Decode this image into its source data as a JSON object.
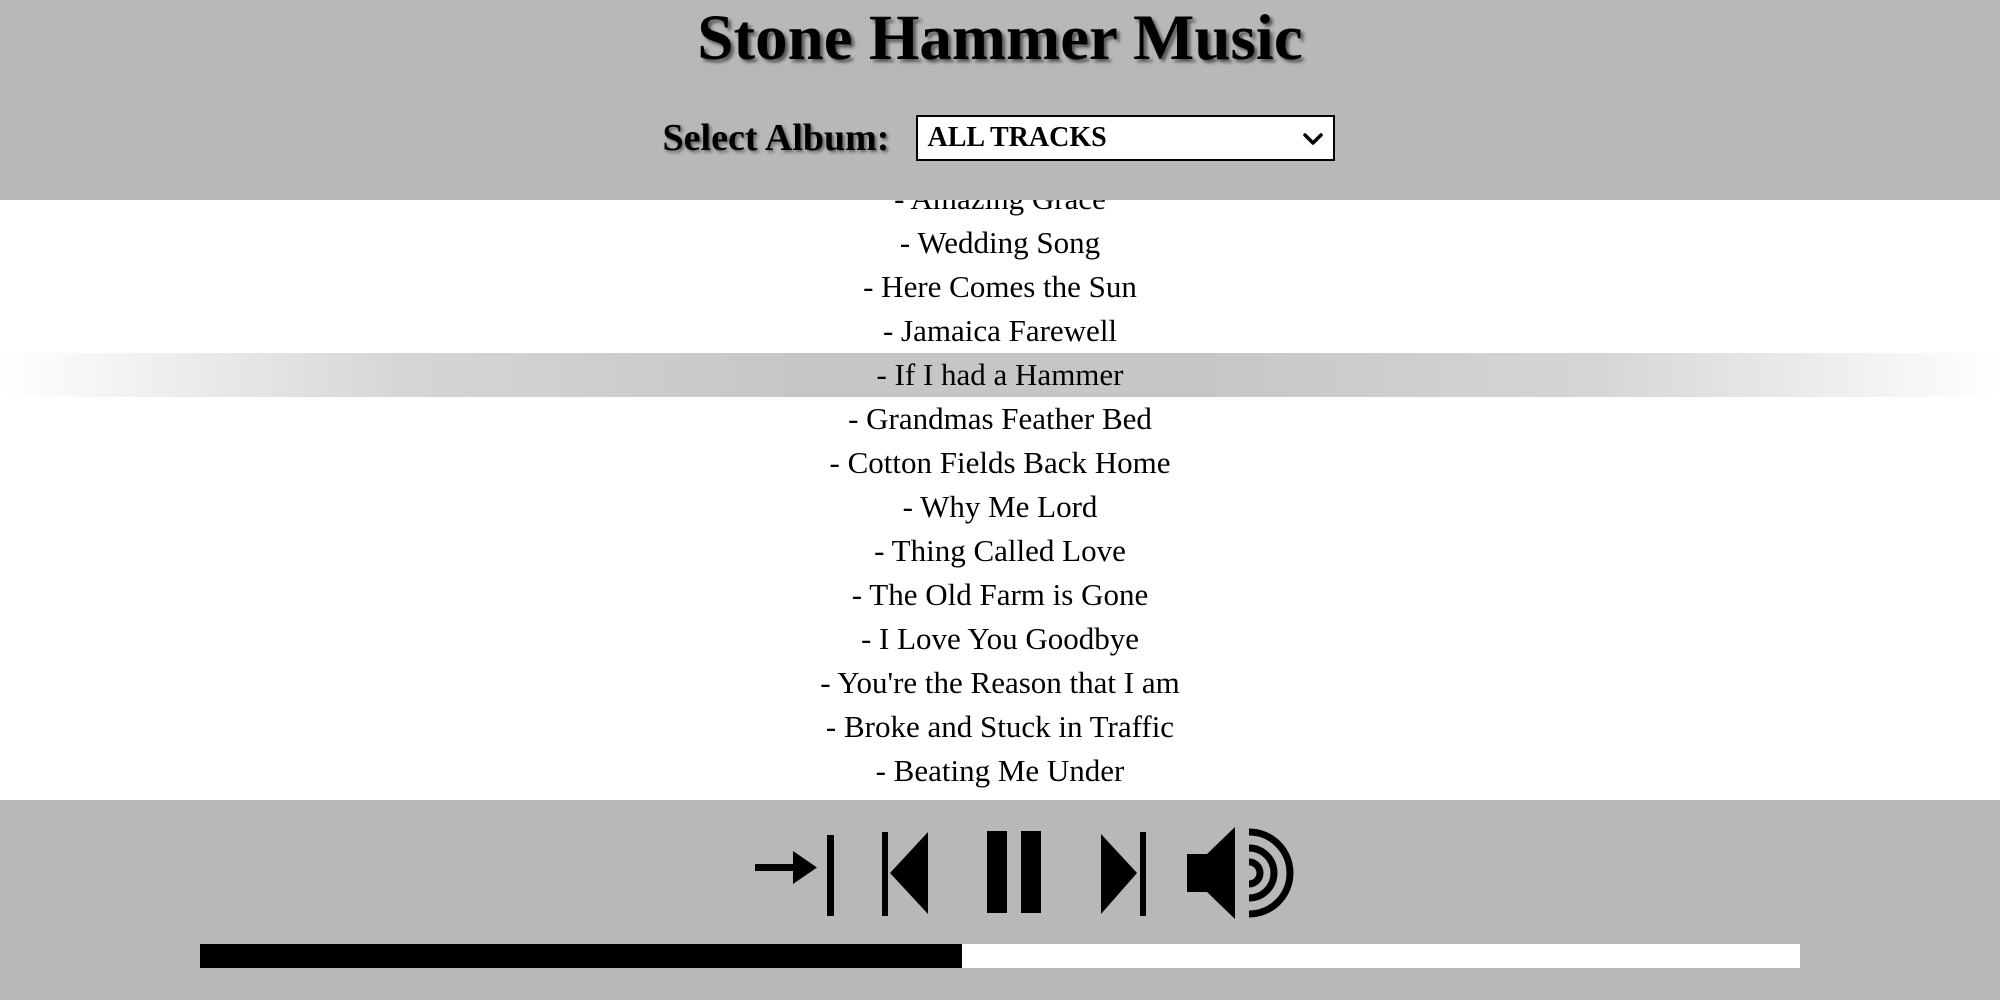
{
  "header": {
    "title": "Stone Hammer Music",
    "album_label": "Select Album:",
    "album_selected": "ALL TRACKS"
  },
  "tracks": [
    "- Amazing Grace",
    "- Wedding Song",
    "- Here Comes the Sun",
    "- Jamaica Farewell",
    "- If I had a Hammer",
    "- Grandmas Feather Bed",
    "- Cotton Fields Back Home",
    "- Why Me Lord",
    "- Thing Called Love",
    "- The Old Farm is Gone",
    "- I Love You Goodbye",
    "- You're the Reason that I am",
    "- Broke and Stuck in Traffic",
    "- Beating Me Under"
  ],
  "active_track_index": 4,
  "player": {
    "controls": [
      "shuffle-icon",
      "previous-icon",
      "pause-icon",
      "next-icon",
      "volume-icon"
    ],
    "progress_fraction": 0.476
  },
  "colors": {
    "bar_background": "#b8b8b8",
    "active_row": "#c6c6c6",
    "progress_fill": "#000000",
    "progress_track": "#ffffff"
  }
}
